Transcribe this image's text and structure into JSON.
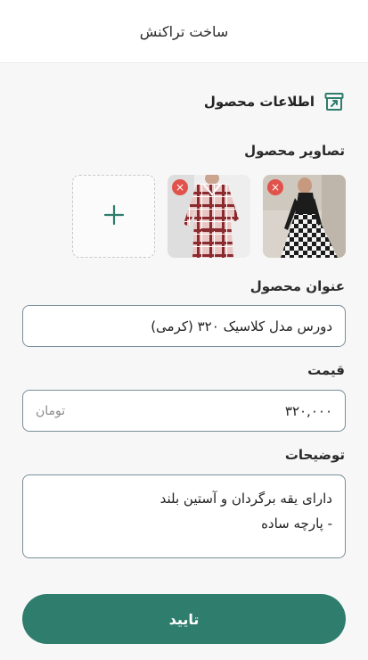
{
  "header": {
    "title": "ساخت تراکنش"
  },
  "section": {
    "title": "اطلاعات محصول",
    "icon": "box-archive-icon"
  },
  "images": {
    "label": "تصاویر محصول",
    "remove_symbol": "×",
    "add_symbol": "+"
  },
  "title_field": {
    "label": "عنوان محصول",
    "value": "دورس مدل کلاسیک ۳۲۰ (کرمی)"
  },
  "price_field": {
    "label": "قیمت",
    "value": "۳۲۰,۰۰۰",
    "unit": "تومان"
  },
  "description_field": {
    "label": "توضیحات",
    "lines": [
      "دارای یقه برگردان و آستین بلند",
      "- پارچه ساده"
    ]
  },
  "submit": {
    "label": "تایید"
  },
  "colors": {
    "primary": "#2e7d6d",
    "remove": "#e0524b",
    "border": "#7a8f99"
  }
}
